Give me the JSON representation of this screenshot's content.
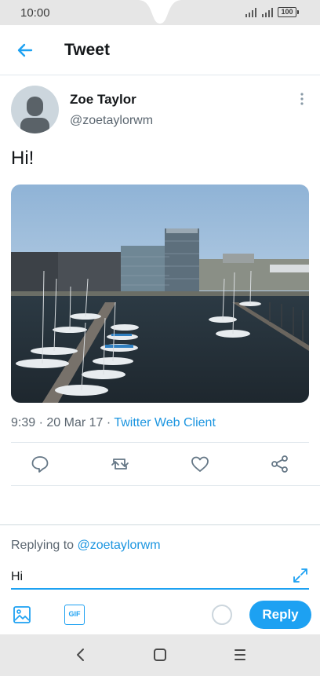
{
  "status_bar": {
    "time": "10:00",
    "battery": "100"
  },
  "header": {
    "title": "Tweet"
  },
  "tweet": {
    "author_name": "Zoe Taylor",
    "author_handle": "@zoetaylorwm",
    "text": "Hi!",
    "time": "9:39",
    "date": "20 Mar 17",
    "separator": "·",
    "client": "Twitter Web Client"
  },
  "actions": [
    "reply-icon",
    "retweet-icon",
    "like-icon",
    "share-icon"
  ],
  "composer": {
    "replying_prefix": "Replying to",
    "replying_to": "@zoetaylorwm",
    "input_value": "Hi",
    "gif_label": "GIF",
    "reply_label": "Reply"
  },
  "colors": {
    "accent": "#1da1f2",
    "link": "#1b95e0",
    "secondary_text": "#5b6670"
  }
}
